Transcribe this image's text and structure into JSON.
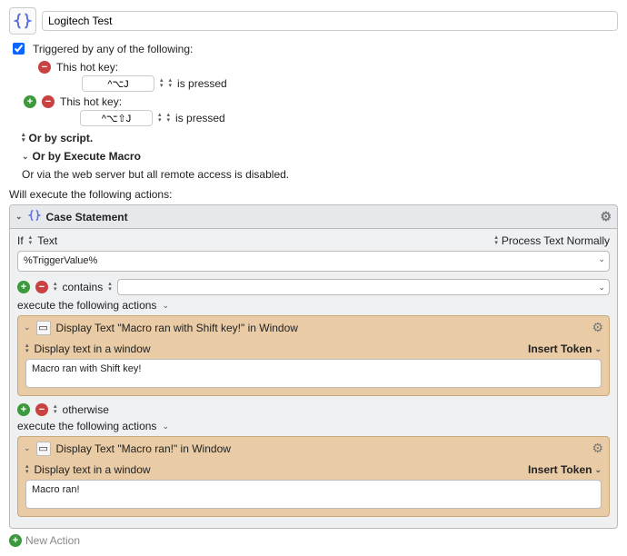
{
  "macro": {
    "name": "Logitech Test"
  },
  "trigger": {
    "label": "Triggered by any of the following:",
    "hotkeys": [
      {
        "prefix": "This hot key:",
        "combo": "^⌥J",
        "mode": "is pressed"
      },
      {
        "prefix": "This hot key:",
        "combo": "^⌥⇧J",
        "mode": "is pressed"
      }
    ],
    "or_script": "Or by script.",
    "or_execute": "Or by Execute Macro",
    "or_web": "Or via the web server but all remote access is disabled."
  },
  "actions": {
    "label": "Will execute the following actions:",
    "case": {
      "title": "Case Statement",
      "if_label": "If",
      "if_subject": "Text",
      "process_mode": "Process Text Normally",
      "text_value": "%TriggerValue%",
      "conditions": [
        {
          "op": "contains",
          "value": "",
          "exec_label": "execute the following actions",
          "action": {
            "title": "Display Text \"Macro ran with Shift key!\" in Window",
            "mode": "Display text in a window",
            "insert_token": "Insert Token",
            "body": "Macro ran with Shift key!"
          }
        },
        {
          "op": "otherwise",
          "exec_label": "execute the following actions",
          "action": {
            "title": "Display Text \"Macro ran!\" in Window",
            "mode": "Display text in a window",
            "insert_token": "Insert Token",
            "body": "Macro ran!"
          }
        }
      ]
    },
    "new_action": "New Action"
  }
}
